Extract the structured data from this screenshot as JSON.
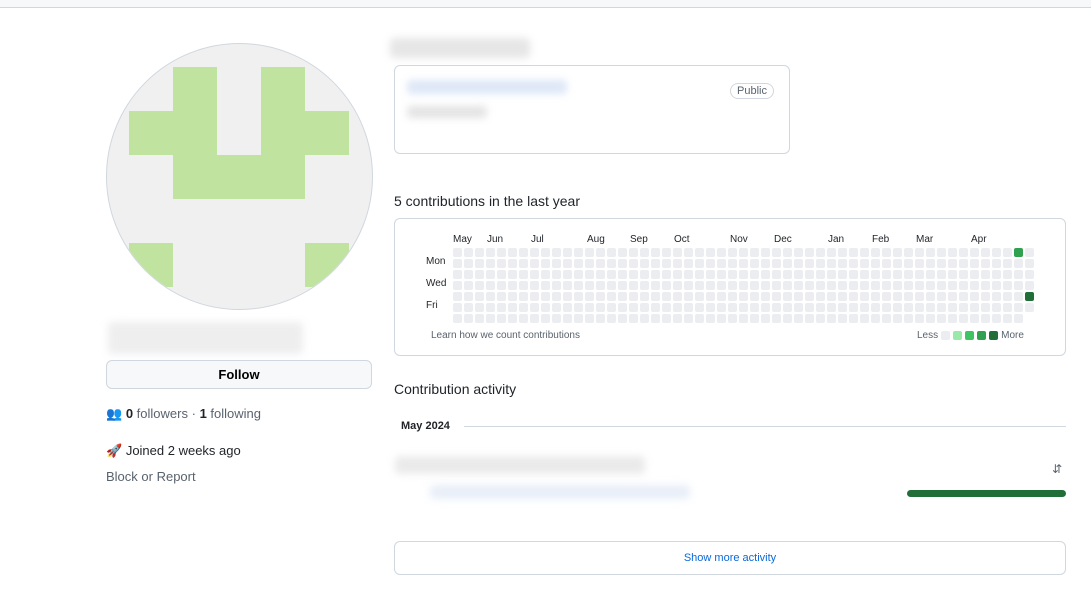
{
  "profile": {
    "follow_label": "Follow",
    "followers_count": "0",
    "followers_label": "followers",
    "separator": "·",
    "following_count": "1",
    "following_label": "following",
    "joined": "Joined 2 weeks ago",
    "block_report": "Block or Report"
  },
  "pinned": {
    "badge": "Public"
  },
  "contributions": {
    "heading": "5 contributions in the last year",
    "months": [
      "May",
      "Jun",
      "Jul",
      "Aug",
      "Sep",
      "Oct",
      "Nov",
      "Dec",
      "Jan",
      "Feb",
      "Mar",
      "Apr"
    ],
    "days": [
      "Mon",
      "Wed",
      "Fri"
    ],
    "learn_link": "Learn how we count contributions",
    "less": "Less",
    "more": "More",
    "colors": [
      "#ebedf0",
      "#9be9a8",
      "#40c463",
      "#30a14e",
      "#216e39"
    ]
  },
  "activity": {
    "heading": "Contribution activity",
    "month": "May 2024",
    "show_more": "Show more activity",
    "bar_color": "#216e39"
  }
}
